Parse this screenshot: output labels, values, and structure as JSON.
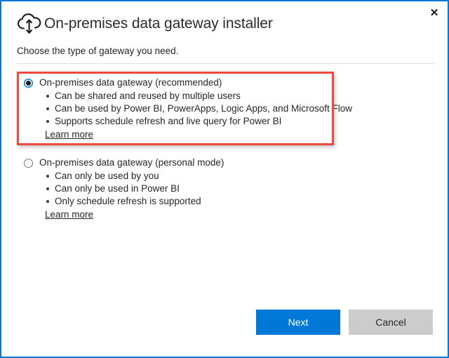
{
  "window": {
    "border_color": "#0078D7",
    "background": "#ffffff"
  },
  "header": {
    "icon": "cloud-sync-icon",
    "title": "On-premises data gateway installer",
    "close_label": "✕"
  },
  "subtitle": "Choose the type of gateway you need.",
  "annotation": {
    "highlight_color": "#f0483e",
    "target": "option-recommended"
  },
  "options": [
    {
      "id": "recommended",
      "label": "On-premises data gateway (recommended)",
      "selected": true,
      "bullets": [
        "Can be shared and reused by multiple users",
        "Can be used by Power BI, PowerApps, Logic Apps, and Microsoft Flow",
        "Supports schedule refresh and live query for Power BI"
      ],
      "link": "Learn more"
    },
    {
      "id": "personal",
      "label": "On-premises data gateway (personal mode)",
      "selected": false,
      "bullets": [
        "Can only be used by you",
        "Can only be used in Power BI",
        "Only schedule refresh is supported"
      ],
      "link": "Learn more"
    }
  ],
  "footer": {
    "next_label": "Next",
    "cancel_label": "Cancel",
    "next_color": "#0078D7",
    "cancel_color": "#cccccc"
  }
}
